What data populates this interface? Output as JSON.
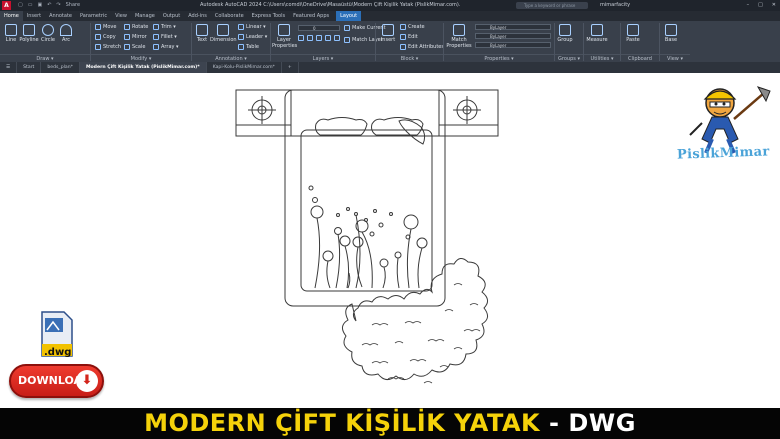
{
  "titlebar": {
    "app_letter": "A",
    "share": "Share",
    "title": "Autodesk AutoCAD 2024   C:\\Users\\comdi\\OneDrive\\Masaüstü\\Modern Çift Kişilik Yatak (PislikMimar.com).dwg",
    "search_placeholder": "Type a keyword or phrase",
    "user": "mimarfacity"
  },
  "tabs": [
    "Home",
    "Insert",
    "Annotate",
    "Parametric",
    "View",
    "Manage",
    "Output",
    "Add-ins",
    "Collaborate",
    "Express Tools",
    "Featured Apps",
    "Layout"
  ],
  "ribbon": {
    "draw": {
      "line": "Line",
      "polyline": "Polyline",
      "circle": "Circle",
      "arc": "Arc",
      "panel": "Draw ▾"
    },
    "modify": {
      "move": "Move",
      "rotate": "Rotate",
      "trim": "Trim ▾",
      "copy": "Copy",
      "mirror": "Mirror",
      "fillet": "Fillet ▾",
      "stretch": "Stretch",
      "scale": "Scale",
      "array": "Array ▾",
      "panel": "Modify ▾"
    },
    "annotation": {
      "text": "Text",
      "dimension": "Dimension",
      "linear": "Linear ▾",
      "leader": "Leader ▾",
      "table": "Table",
      "panel": "Annotation ▾"
    },
    "layers": {
      "layer_properties": "Layer Properties",
      "current": "0",
      "make_current": "Make Current",
      "match_layer": "Match Layer",
      "panel": "Layers ▾"
    },
    "block": {
      "insert": "Insert",
      "create": "Create",
      "edit": "Edit",
      "edit_attributes": "Edit Attributes",
      "panel": "Block ▾"
    },
    "properties": {
      "match": "Match Properties",
      "color": "ByLayer",
      "linetype": "ByLayer",
      "lineweight": "ByLayer",
      "panel": "Properties ▾"
    },
    "groups": {
      "group": "Group",
      "panel": "Groups ▾"
    },
    "utilities": {
      "measure": "Measure",
      "panel": "Utilities ▾"
    },
    "clipboard": {
      "paste": "Paste",
      "panel": "Clipboard"
    },
    "view": {
      "base": "Base",
      "panel": "View ▾"
    }
  },
  "doc_tabs": [
    "Start",
    "beds_plan*",
    "Modern Çift Kişilik Yatak (PislikMimar.com)*",
    "Kapi-Kolu-PislikMimar.com*",
    "+"
  ],
  "overlay": {
    "brand": "PislikMimar",
    "dwg_label": ".dwg",
    "download": "DOWNLOAD",
    "download_glyph": "⬇"
  },
  "footer": {
    "title": "MODERN ÇİFT KİŞİLİK YATAK",
    "suffix": " - DWG"
  },
  "colors": {
    "accent": "#2b6fb8",
    "footer_yellow": "#f5d20a",
    "download_red": "#d3251c",
    "brand_blue": "#4aa3d8"
  }
}
